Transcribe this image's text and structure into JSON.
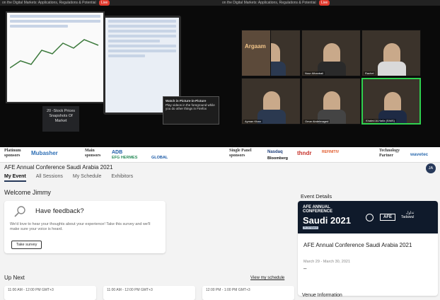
{
  "video": {
    "left_strip_text": "on the Digital Markets: Applications, Regulations & Potential",
    "left_strip_badge": "Live",
    "pip_title": "Watch in Picture-in-Picture",
    "pip_body": "Play videos in the foreground while you do other things in Firefox",
    "ticker_lines": [
      "20 -Stock Prices",
      "Snapshots Of Market"
    ],
    "participants": [
      {
        "name": "Mohsen Radi"
      },
      {
        "name": "Nour Alhanbali"
      },
      {
        "name": "Rachel"
      },
      {
        "name": "Ayman Khan"
      },
      {
        "name": "Omar Abdelmaged"
      },
      {
        "name": "Khaled Al-Hafiz (SIMS)"
      }
    ],
    "tile_logo": "Argaam"
  },
  "sponsors": {
    "platinum_label": "Platinum sponsors",
    "platinum_logo": "Mubasher",
    "main_label": "Main sponsors",
    "main_logos": [
      "ADB",
      "EFG HERMES",
      "GLOBAL"
    ],
    "panel_label": "Single Panel sponsors",
    "panel_logos": [
      "Nasdaq",
      "Bloomberg",
      "thndr",
      "REFINITIV"
    ],
    "tech_label": "Technology Partner",
    "tech_logo": "wavetec"
  },
  "header": {
    "title": "AFE Annual Conference Saudi Arabia 2021",
    "avatar_initials": "JA",
    "tabs": [
      {
        "label": "My Event",
        "active": true
      },
      {
        "label": "All Sessions",
        "active": false
      },
      {
        "label": "My Schedule",
        "active": false
      },
      {
        "label": "Exhibitors",
        "active": false
      }
    ]
  },
  "welcome": "Welcome Jimmy",
  "feedback": {
    "title": "Have feedback?",
    "body": "We'd love to hear your thoughts about your experience! Take this survey and we'll make sure your voice is heard.",
    "button": "Take survey"
  },
  "upnext": {
    "title": "Up Next",
    "link": "View my schedule",
    "sessions": [
      {
        "time": "11:00 AM - 12:00 PM GMT+3"
      },
      {
        "time": "11:00 AM - 12:00 PM GMT+3"
      },
      {
        "time": "12:00 PM - 1:00 PM GMT+3"
      }
    ]
  },
  "event": {
    "section_title": "Event Details",
    "banner_line1": "AFE ANNUAL",
    "banner_line2": "CONFERENCE",
    "banner_big": "Saudi 2021",
    "banner_dates": "29-30 March",
    "banner_afe": "AFE",
    "banner_tadawul_ar": "تداول",
    "banner_tadawul_en": "Tadawul",
    "name": "AFE Annual Conference Saudi Arabia 2021",
    "dates": "March 29 - March 30, 2021",
    "dash": "–"
  },
  "venue_title": "Venue Information"
}
